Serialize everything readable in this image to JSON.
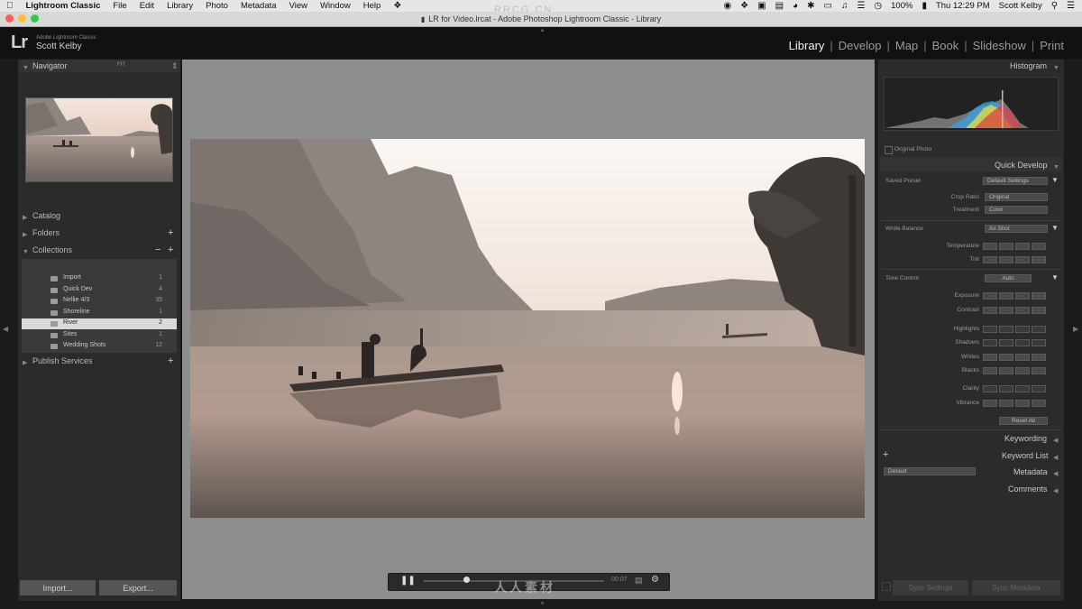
{
  "menubar": {
    "app": "Lightroom Classic",
    "items": [
      "File",
      "Edit",
      "Library",
      "Photo",
      "Metadata",
      "View",
      "Window",
      "Help"
    ],
    "battery": "100%",
    "clock": "Thu 12:29 PM",
    "user": "Scott Kelby"
  },
  "window": {
    "title": "LR for Video.lrcat - Adobe Photoshop Lightroom Classic - Library"
  },
  "watermark": {
    "top": "RRCG.CN",
    "bottom": "人人素材"
  },
  "identity": {
    "logo": "Lr",
    "product": "Adobe Lightroom Classic",
    "user": "Scott Kelby"
  },
  "modules": [
    "Library",
    "Develop",
    "Map",
    "Book",
    "Slideshow",
    "Print"
  ],
  "active_module": "Library",
  "left": {
    "navigator": "Navigator",
    "navigator_zoom": "FIT",
    "catalog": "Catalog",
    "folders": "Folders",
    "collections": "Collections",
    "collection_items": [
      {
        "name": "Import",
        "count": "1"
      },
      {
        "name": "Quick Dev",
        "count": "4"
      },
      {
        "name": "Nellie 4/3",
        "count": "35"
      },
      {
        "name": "Shoreline",
        "count": "1"
      },
      {
        "name": "River",
        "count": "2"
      },
      {
        "name": "Sites",
        "count": "1"
      },
      {
        "name": "Wedding Shots",
        "count": "12"
      }
    ],
    "publish": "Publish Services",
    "import_btn": "Import...",
    "export_btn": "Export..."
  },
  "right": {
    "histogram": "Histogram",
    "original_photo": "Original Photo",
    "quick_develop": "Quick Develop",
    "saved_preset_label": "Saved Preset",
    "saved_preset_value": "Default Settings",
    "crop_ratio_label": "Crop Ratio",
    "crop_ratio_value": "Original",
    "treatment_label": "Treatment",
    "treatment_value": "Color",
    "white_balance_label": "White Balance",
    "white_balance_value": "As Shot",
    "temperature": "Temperature",
    "tint": "Tint",
    "tone_control": "Tone Control",
    "auto": "Auto",
    "exposure": "Exposure",
    "contrast": "Contrast",
    "highlights": "Highlights",
    "shadows": "Shadows",
    "whites": "Whites",
    "blacks": "Blacks",
    "clarity": "Clarity",
    "vibrance": "Vibrance",
    "reset_all": "Reset All",
    "keywording": "Keywording",
    "keyword_list": "Keyword List",
    "metadata": "Metadata",
    "metadata_preset": "Default",
    "comments": "Comments",
    "sync_settings": "Sync Settings",
    "sync_metadata": "Sync Metadata"
  },
  "toolbar": {
    "time": "00:07"
  }
}
